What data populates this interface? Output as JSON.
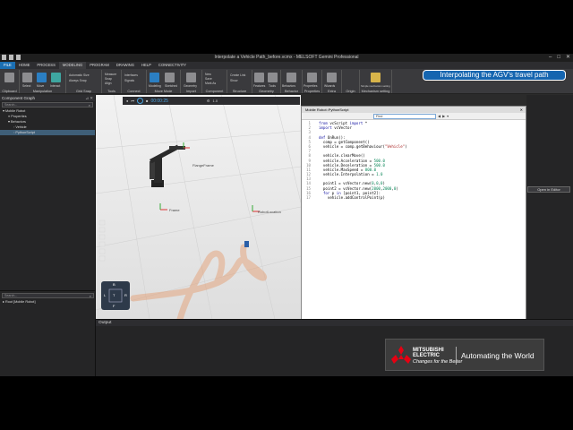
{
  "window": {
    "title": "Interpolate a Vehicle Path_before.vcmx - MELSOFT Gemini Professional",
    "controls": [
      "–",
      "□",
      "✕"
    ]
  },
  "menu": {
    "tabs": [
      "FILE",
      "HOME",
      "PROCESS",
      "MODELING",
      "PROGRAM",
      "DRAWING",
      "HELP",
      "CONNECTIVITY"
    ],
    "active": "MODELING"
  },
  "ribbon": {
    "groups": [
      "Clipboard",
      "Manipulation",
      "Grid Snap",
      "Tools",
      "Connect",
      "Move Mode",
      "Import",
      "Component",
      "Structure",
      "Geometry",
      "Behavior",
      "Properties",
      "Extra",
      "Origin",
      "Mechanism setting"
    ],
    "buttons": [
      "Select",
      "Move",
      "Interact",
      "Measure",
      "Snap",
      "Align",
      "Interfaces",
      "Signals",
      "Modeling",
      "Sketched",
      "Geometry",
      "New",
      "Save",
      "Mark As",
      "Create Link",
      "Show",
      "Features",
      "Tools",
      "Behaviors",
      "Properties",
      "Wizards",
      "Simple mechanism setting"
    ],
    "options": [
      "Automatic Size",
      "Always Snap"
    ]
  },
  "banner": "Interpolating the AGV's travel path",
  "component_graph": {
    "title": "Component Graph",
    "search_placeholder": "Search...",
    "tree": [
      "Mobile Robot",
      "Properties",
      "Behaviors",
      "Vehicle",
      "PythonScript"
    ],
    "selected": "PythonScript",
    "bottom_tree": [
      "Root [Mobile Robot]"
    ]
  },
  "viewport": {
    "labels": [
      "FlangeFrame",
      "Frame",
      "RobotLocation"
    ],
    "timer": "00:00:25",
    "speed": "1.0",
    "compass": [
      "B",
      "L",
      "T",
      "R",
      "F"
    ]
  },
  "editor": {
    "title": "Mobile Robot::PythonScript",
    "find_label": "Find",
    "status": "Ln 14",
    "lines": [
      "from vcScript import *",
      "import vcVector",
      "",
      "def OnRun():",
      "  comp = getComponent()",
      "  vehicle = comp.getBehaviour(\"Vehicle\")",
      "",
      "  vehicle.clearMove()",
      "  vehicle.Acceleration = 500.0",
      "  vehicle.Deceleration = 500.0",
      "  vehicle.MaxSpeed = 800.0",
      "  vehicle.Interpolation = 1.0",
      "",
      "  point1 = vcVector.new(0,0,0)",
      "  point2 = vcVector.new(2000,2000,0)",
      "  for p in [point1, point2]:",
      "    vehicle.addControlPoint(p)"
    ]
  },
  "right_panel": {
    "button": "Open in Editor"
  },
  "output": {
    "title": "Output"
  },
  "logo": {
    "brand_line1": "MITSUBISHI",
    "brand_line2": "ELECTRIC",
    "slogan": "Changes for the Better",
    "tagline": "Automating the World"
  },
  "colors": {
    "accent": "#1b6fb3",
    "banner": "#1565b0",
    "path": "#e59a6a"
  }
}
